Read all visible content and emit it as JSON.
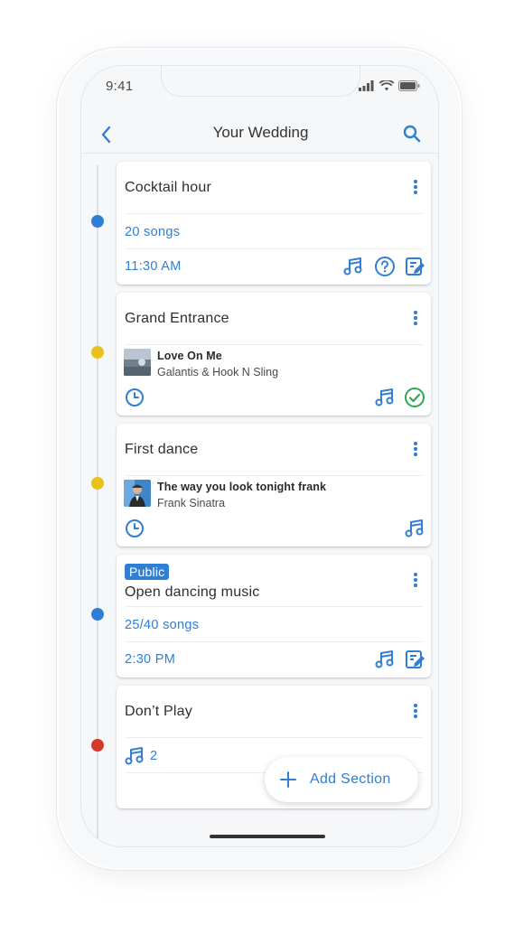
{
  "status_bar": {
    "time": "9:41"
  },
  "nav": {
    "title": "Your Wedding"
  },
  "colors": {
    "accent": "#2f7fd5",
    "dot_blue": "#2f7fd5",
    "dot_yellow": "#e8c21c",
    "dot_red": "#d33a2c",
    "check_green": "#2fa84f"
  },
  "sections": [
    {
      "title": "Cocktail hour",
      "songs": "20 songs",
      "time": "11:30 AM",
      "icons": [
        "music-note-icon",
        "help-circle-icon",
        "edit-note-icon"
      ]
    },
    {
      "title": "Grand Entrance",
      "track": {
        "title": "Love On Me",
        "artist": "Galantis & Hook N Sling"
      },
      "icons": [
        "clock-icon",
        "music-note-icon",
        "check-circle-icon"
      ]
    },
    {
      "title": "First dance",
      "track": {
        "title": "The way you look tonight frank",
        "artist": "Frank Sinatra"
      },
      "icons": [
        "clock-icon",
        "music-note-icon"
      ]
    },
    {
      "badge": "Public",
      "title": "Open dancing music",
      "songs": "25/40 songs",
      "time": "2:30 PM",
      "icons": [
        "music-note-icon",
        "edit-note-icon"
      ]
    },
    {
      "title": "Don’t Play",
      "count": "2",
      "icons": [
        "music-note-icon"
      ]
    }
  ],
  "fab": {
    "label": "Add Section"
  }
}
